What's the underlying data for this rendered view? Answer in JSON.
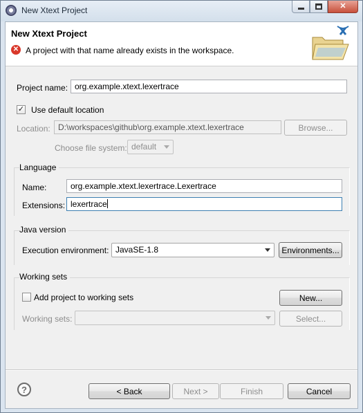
{
  "window": {
    "title": "New Xtext Project",
    "minimize_glyph": "minimize",
    "maximize_glyph": "maximize",
    "close_glyph": "✕"
  },
  "header": {
    "title": "New Xtext Project",
    "error_message": "A project with that name already exists in the workspace.",
    "error_icon": "error-icon",
    "banner_icon": "folder-xtext-icon"
  },
  "project": {
    "name_label": "Project name:",
    "name_value": "org.example.xtext.lexertrace",
    "use_default_label": "Use default location",
    "use_default_checked": true,
    "location_label": "Location:",
    "location_value": "D:\\workspaces\\github\\org.example.xtext.lexertrace",
    "browse_label": "Browse...",
    "file_system_label": "Choose file system:",
    "file_system_value": "default"
  },
  "language": {
    "group_title": "Language",
    "name_label": "Name:",
    "name_value": "org.example.xtext.lexertrace.Lexertrace",
    "extensions_label": "Extensions:",
    "extensions_value": "lexertrace"
  },
  "java": {
    "group_title": "Java version",
    "env_label": "Execution environment:",
    "env_value": "JavaSE-1.8",
    "environments_label": "Environments..."
  },
  "working_sets": {
    "group_title": "Working sets",
    "add_label": "Add project to working sets",
    "add_checked": false,
    "new_label": "New...",
    "sets_label": "Working sets:",
    "sets_value": "",
    "select_label": "Select..."
  },
  "footer": {
    "help_glyph": "?",
    "back_label": "< Back",
    "next_label": "Next >",
    "finish_label": "Finish",
    "cancel_label": "Cancel"
  }
}
